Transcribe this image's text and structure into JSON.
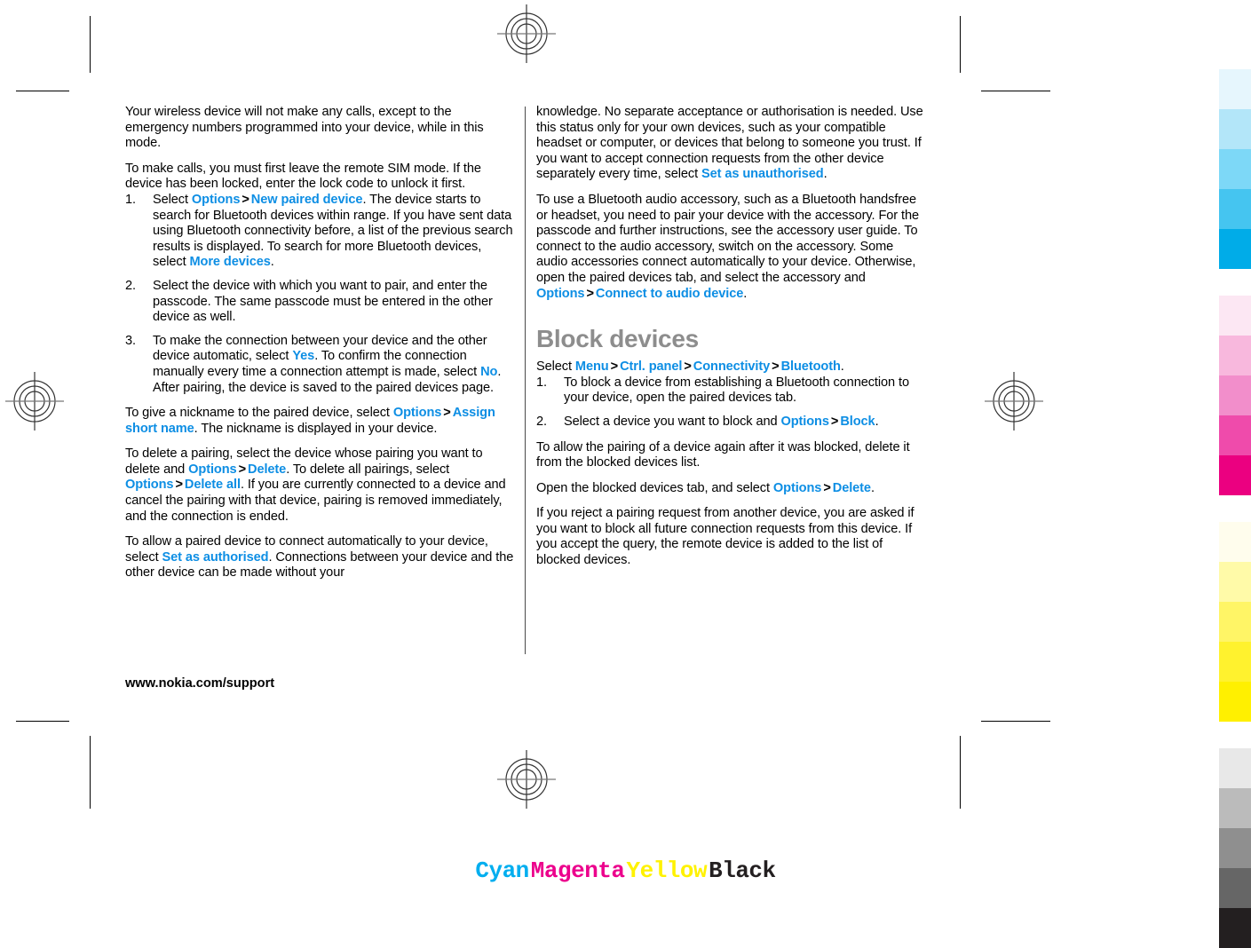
{
  "document": {
    "footer_url": "www.nokia.com/support",
    "link_color": "#0d8ee4",
    "heading_color": "#8d8d8d",
    "gt_separator": ">"
  },
  "left_column": {
    "paragraphs": [
      {
        "id": "p-remote-sim-calls",
        "runs": [
          {
            "t": "Your wireless device will not make any calls, except to the emergency numbers programmed into your device, while in this mode."
          }
        ]
      },
      {
        "id": "p-make-calls",
        "runs": [
          {
            "t": "To make calls, you must first leave the remote SIM mode. If the device has been locked, enter the lock code to unlock it first."
          }
        ]
      }
    ],
    "steps": [
      {
        "id": "step-1",
        "num": "1.",
        "runs": [
          {
            "t": "Select "
          },
          {
            "t": "Options",
            "style": "link"
          },
          {
            "t": ">",
            "style": "gt"
          },
          {
            "t": "New paired device",
            "style": "link"
          },
          {
            "t": ". The device starts to search for Bluetooth devices within range. If you have sent data using Bluetooth connectivity before, a list of the previous search results is displayed. To search for more Bluetooth devices, select "
          },
          {
            "t": "More devices",
            "style": "link"
          },
          {
            "t": "."
          }
        ]
      },
      {
        "id": "step-2",
        "num": "2.",
        "runs": [
          {
            "t": "Select the device with which you want to pair, and enter the passcode. The same passcode must be entered in the other device as well."
          }
        ]
      },
      {
        "id": "step-3",
        "num": "3.",
        "runs": [
          {
            "t": "To make the connection between your device and the other device automatic, select "
          },
          {
            "t": "Yes",
            "style": "link"
          },
          {
            "t": ". To confirm the connection manually every time a connection attempt is made, select "
          },
          {
            "t": "No",
            "style": "link"
          },
          {
            "t": ". After pairing, the device is saved to the paired devices page."
          }
        ]
      }
    ],
    "paragraphs_after": [
      {
        "id": "p-nickname",
        "runs": [
          {
            "t": "To give a nickname to the paired device, select "
          },
          {
            "t": "Options",
            "style": "link"
          },
          {
            "t": ">",
            "style": "gt"
          },
          {
            "t": "Assign short name",
            "style": "link"
          },
          {
            "t": ". The nickname is displayed in your device."
          }
        ]
      },
      {
        "id": "p-delete-pairing",
        "runs": [
          {
            "t": "To delete a pairing, select the device whose pairing you want to delete and "
          },
          {
            "t": "Options",
            "style": "link"
          },
          {
            "t": ">",
            "style": "gt"
          },
          {
            "t": "Delete",
            "style": "link"
          },
          {
            "t": ". To delete all pairings, select "
          },
          {
            "t": "Options",
            "style": "link"
          },
          {
            "t": ">",
            "style": "gt"
          },
          {
            "t": "Delete all",
            "style": "link"
          },
          {
            "t": ". If you are currently connected to a device and cancel the pairing with that device, pairing is removed immediately, and the connection is ended."
          }
        ]
      },
      {
        "id": "p-authorised",
        "runs": [
          {
            "t": "To allow a paired device to connect automatically to your device, select "
          },
          {
            "t": "Set as authorised",
            "style": "link"
          },
          {
            "t": ". Connections between your device and the other device can be made without your"
          }
        ]
      }
    ]
  },
  "right_column": {
    "paragraphs": [
      {
        "id": "p-knowledge",
        "runs": [
          {
            "t": "knowledge. No separate acceptance or authorisation is needed. Use this status only for your own devices, such as your compatible headset or computer, or devices that belong to someone you trust. If you want to accept connection requests from the other device separately every time, select "
          },
          {
            "t": "Set as unauthorised",
            "style": "link"
          },
          {
            "t": "."
          }
        ]
      },
      {
        "id": "p-audio-accessory",
        "runs": [
          {
            "t": "To use a Bluetooth audio accessory, such as a Bluetooth handsfree or headset, you need to pair your device with the accessory. For the passcode and further instructions, see the accessory user guide. To connect to the audio accessory, switch on the accessory. Some audio accessories connect automatically to your device. Otherwise, open the paired devices tab, and select the accessory and "
          },
          {
            "t": "Options",
            "style": "link"
          },
          {
            "t": ">",
            "style": "gt"
          },
          {
            "t": "Connect to audio device",
            "style": "link"
          },
          {
            "t": "."
          }
        ]
      }
    ],
    "section_heading": "Block devices",
    "path_paragraph": {
      "id": "p-block-path",
      "runs": [
        {
          "t": "Select "
        },
        {
          "t": "Menu",
          "style": "link"
        },
        {
          "t": ">",
          "style": "gt"
        },
        {
          "t": "Ctrl. panel",
          "style": "link"
        },
        {
          "t": ">",
          "style": "gt"
        },
        {
          "t": "Connectivity",
          "style": "link"
        },
        {
          "t": ">",
          "style": "gt"
        },
        {
          "t": "Bluetooth",
          "style": "link"
        },
        {
          "t": "."
        }
      ]
    },
    "steps": [
      {
        "id": "block-step-1",
        "num": "1.",
        "runs": [
          {
            "t": "To block a device from establishing a Bluetooth connection to your device, open the paired devices tab."
          }
        ]
      },
      {
        "id": "block-step-2",
        "num": "2.",
        "runs": [
          {
            "t": "Select a device you want to block and "
          },
          {
            "t": "Options",
            "style": "link"
          },
          {
            "t": ">",
            "style": "gt"
          },
          {
            "t": "Block",
            "style": "link"
          },
          {
            "t": "."
          }
        ]
      }
    ],
    "paragraphs_after": [
      {
        "id": "p-allow-again",
        "runs": [
          {
            "t": "To allow the pairing of a device again after it was blocked, delete it from the blocked devices list."
          }
        ]
      },
      {
        "id": "p-open-blocked-tab",
        "runs": [
          {
            "t": "Open the blocked devices tab, and select "
          },
          {
            "t": "Options",
            "style": "link"
          },
          {
            "t": ">",
            "style": "gt"
          },
          {
            "t": "Delete",
            "style": "link"
          },
          {
            "t": "."
          }
        ]
      },
      {
        "id": "p-reject-request",
        "runs": [
          {
            "t": "If you reject a pairing request from another device, you are asked if you want to block all future connection requests from this device. If you accept the query, the remote device is added to the list of blocked devices."
          }
        ]
      }
    ]
  },
  "colour_bars": {
    "groups": [
      {
        "name": "cyan-ramp",
        "swatches": [
          "#e6f6fd",
          "#b3e6f9",
          "#7dd8f7",
          "#45c5f0",
          "#00ace8"
        ]
      },
      {
        "name": "magenta-ramp",
        "swatches": [
          "#fce7f3",
          "#f8b8dd",
          "#f28ecb",
          "#ef4bab",
          "#eb0080"
        ]
      },
      {
        "name": "yellow-ramp",
        "swatches": [
          "#fffded",
          "#fffaa8",
          "#fff566",
          "#fff22e",
          "#fff000"
        ]
      },
      {
        "name": "grey-ramp",
        "swatches": [
          "#e8e8e8",
          "#bbbbbb",
          "#8f8f8f",
          "#666666",
          "#231f20"
        ]
      }
    ]
  },
  "cmyk_legend": [
    {
      "label": "Cyan",
      "color": "#00aeef"
    },
    {
      "label": "Magenta",
      "color": "#ec008c"
    },
    {
      "label": "Yellow",
      "color": "#fff200"
    },
    {
      "label": "Black",
      "color": "#231f20"
    }
  ]
}
